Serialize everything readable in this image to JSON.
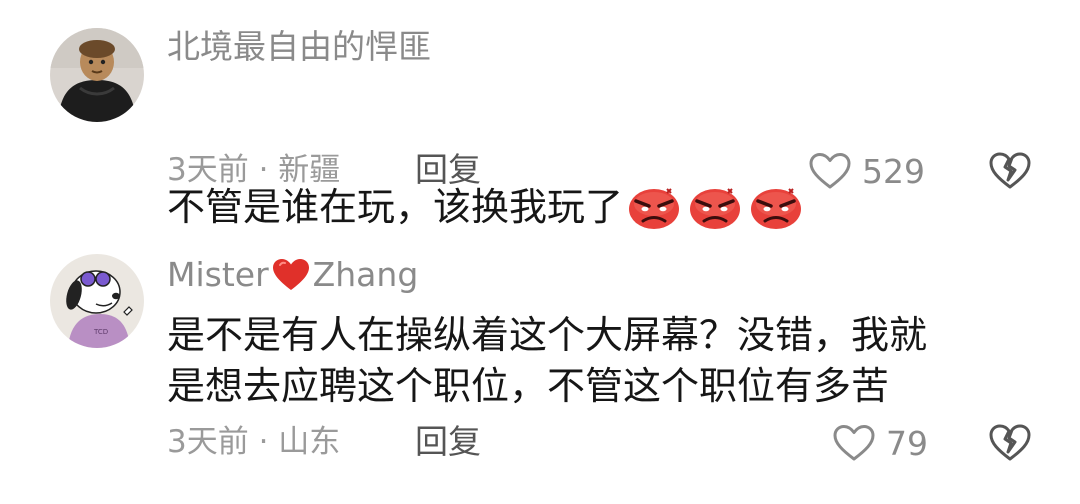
{
  "comments": [
    {
      "username": "北境最自由的悍匪",
      "text": "不管是谁在玩，该换我玩了",
      "emoji_count": 3,
      "emoji": "angry-face-icon",
      "meta": "3天前 · 新疆",
      "reply_label": "回复",
      "likes": "529"
    },
    {
      "username_prefix": "Mister",
      "username_suffix": "Zhang",
      "username_emoji": "red-heart-icon",
      "text": "是不是有人在操纵着这个大屏幕？没错，我就\n是想去应聘这个职位，不管这个职位有多苦",
      "meta": "3天前 · 山东",
      "reply_label": "回复",
      "likes": "79"
    }
  ],
  "colors": {
    "username": "#8a8a8a",
    "text": "#161616",
    "meta": "#9a9a9a",
    "reply": "#555555",
    "icon": "#8a8a8a",
    "heart_emoji": "#e0302a",
    "angry_emoji": "#e53935"
  }
}
